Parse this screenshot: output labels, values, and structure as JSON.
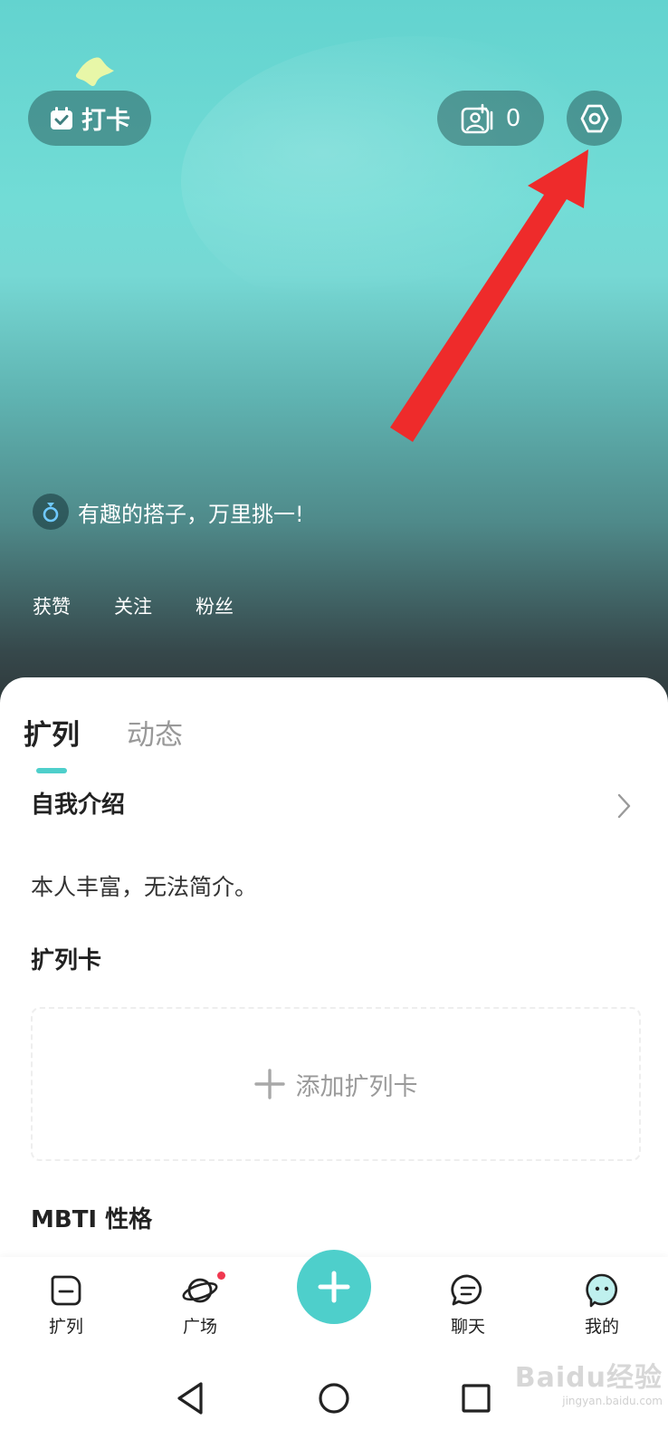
{
  "header": {
    "checkin_label": "打卡",
    "friend_count": "0",
    "signature": "有趣的搭子，万里挑一!",
    "stats": [
      "获赞",
      "关注",
      "粉丝"
    ]
  },
  "tabs": [
    {
      "label": "扩列",
      "active": true
    },
    {
      "label": "动态",
      "active": false
    }
  ],
  "intro": {
    "title": "自我介绍",
    "text": "本人丰富，无法简介。"
  },
  "card": {
    "title": "扩列卡",
    "add_label": "添加扩列卡"
  },
  "mbti": {
    "title": "MBTI 性格"
  },
  "bottom_nav": {
    "items": [
      {
        "label": "扩列",
        "icon": "expand-icon"
      },
      {
        "label": "广场",
        "icon": "planet-icon"
      },
      {
        "label": "聊天",
        "icon": "chat-icon"
      },
      {
        "label": "我的",
        "icon": "profile-face-icon"
      }
    ]
  },
  "watermark": {
    "logo": "Baidu经验",
    "url": "jingyan.baidu.com"
  },
  "colors": {
    "accent": "#4ecfcb",
    "annotation_arrow": "#ee2b2b",
    "notification_dot": "#f0384f"
  }
}
